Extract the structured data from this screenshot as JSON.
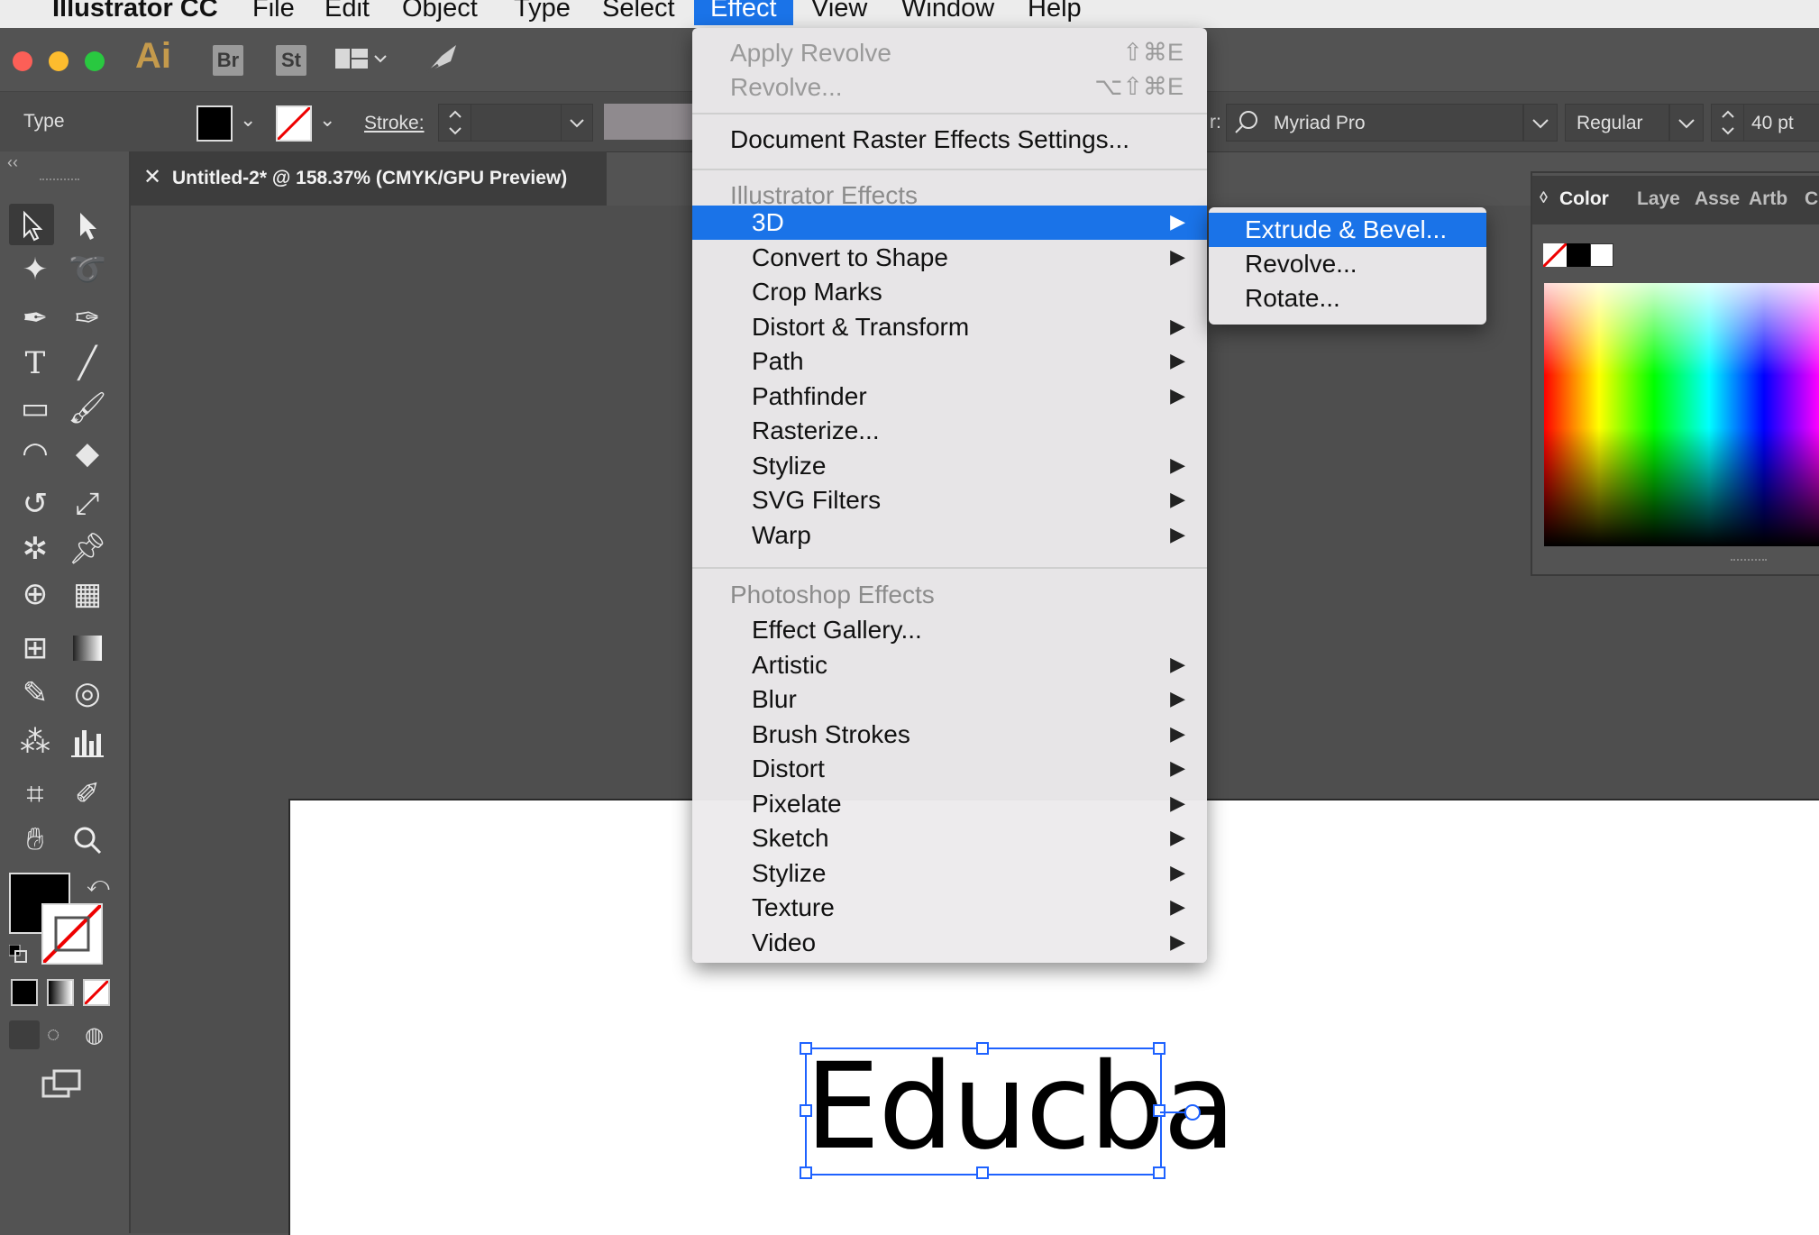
{
  "menubar": {
    "app_name": "Illustrator CC",
    "items": [
      "File",
      "Edit",
      "Object",
      "Type",
      "Select",
      "Effect",
      "View",
      "Window",
      "Help"
    ],
    "active": "Effect"
  },
  "appbar": {
    "logo": "Ai",
    "bridge": "Br",
    "stock": "St"
  },
  "controlbar": {
    "selection_type": "Type",
    "stroke_label": "Stroke:",
    "font_family": "Myriad Pro",
    "font_style": "Regular",
    "font_size": "40 pt",
    "char_label": "r:"
  },
  "document": {
    "tab_title": "Untitled-2* @ 158.37% (CMYK/GPU Preview)",
    "close_glyph": "✕"
  },
  "canvas": {
    "text_object": "Educba"
  },
  "right_panel": {
    "tabs": [
      "Color",
      "Laye",
      "Asse",
      "Artb",
      "C"
    ],
    "active_tab": "Color",
    "collapse_glyph": "‹‹"
  },
  "effect_menu": {
    "apply_last": {
      "label": "Apply Revolve",
      "shortcut": "⇧⌘E"
    },
    "last_effect": {
      "label": "Revolve...",
      "shortcut": "⌥⇧⌘E"
    },
    "raster_settings": "Document Raster Effects Settings...",
    "illustrator_header": "Illustrator Effects",
    "illustrator_items": [
      {
        "label": "3D",
        "submenu": true
      },
      {
        "label": "Convert to Shape",
        "submenu": true
      },
      {
        "label": "Crop Marks",
        "submenu": false
      },
      {
        "label": "Distort & Transform",
        "submenu": true
      },
      {
        "label": "Path",
        "submenu": true
      },
      {
        "label": "Pathfinder",
        "submenu": true
      },
      {
        "label": "Rasterize...",
        "submenu": false
      },
      {
        "label": "Stylize",
        "submenu": true
      },
      {
        "label": "SVG Filters",
        "submenu": true
      },
      {
        "label": "Warp",
        "submenu": true
      }
    ],
    "photoshop_header": "Photoshop Effects",
    "photoshop_items": [
      {
        "label": "Effect Gallery...",
        "submenu": false
      },
      {
        "label": "Artistic",
        "submenu": true
      },
      {
        "label": "Blur",
        "submenu": true
      },
      {
        "label": "Brush Strokes",
        "submenu": true
      },
      {
        "label": "Distort",
        "submenu": true
      },
      {
        "label": "Pixelate",
        "submenu": true
      },
      {
        "label": "Sketch",
        "submenu": true
      },
      {
        "label": "Stylize",
        "submenu": true
      },
      {
        "label": "Texture",
        "submenu": true
      },
      {
        "label": "Video",
        "submenu": true
      }
    ],
    "highlighted": "3D",
    "arrow_glyph": "▶"
  },
  "submenu_3d": {
    "items": [
      "Extrude & Bevel...",
      "Revolve...",
      "Rotate..."
    ],
    "highlighted": "Extrude & Bevel..."
  },
  "colors": {
    "accent": "#1a73e8",
    "ui_dark": "#535353",
    "selection_blue": "#1e62ff",
    "ai_logo": "#c49a4c"
  }
}
